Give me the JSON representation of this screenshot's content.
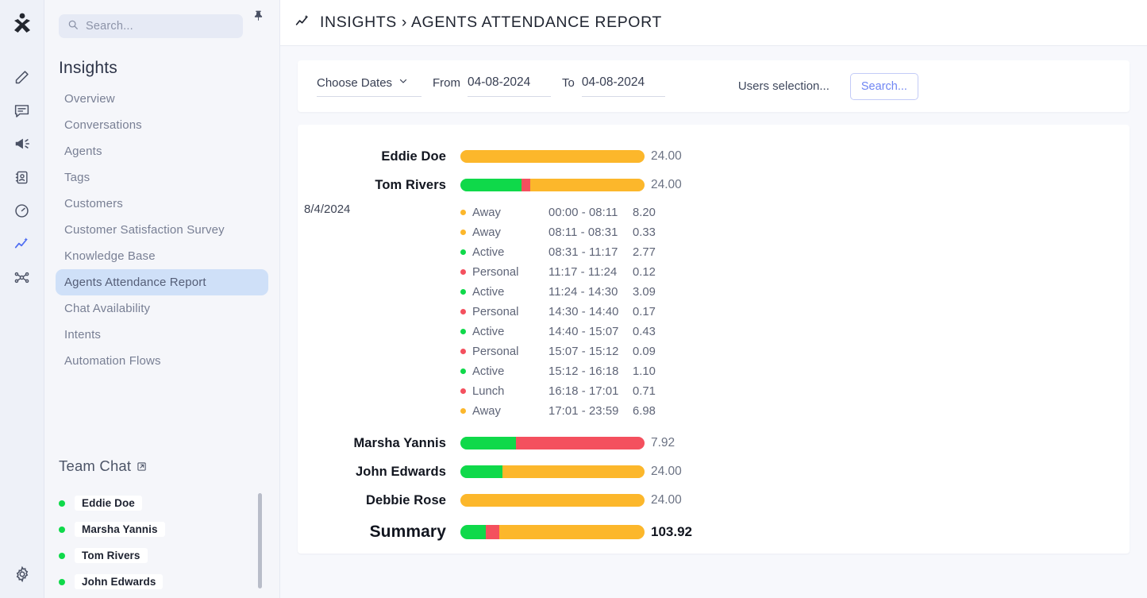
{
  "colors": {
    "active": "#0fd94a",
    "away": "#fcb72b",
    "personal": "#f4505e",
    "lunch": "#f4505e",
    "accent": "#6f85f3",
    "nav_active_bg": "#cfe0f8"
  },
  "rail": {
    "logo_name": "app-logo-icon",
    "items": [
      {
        "icon": "pencil-icon",
        "name": "compose"
      },
      {
        "icon": "chat-bubble-icon",
        "name": "conversations"
      },
      {
        "icon": "megaphone-icon",
        "name": "campaigns"
      },
      {
        "icon": "contact-card-icon",
        "name": "contacts"
      },
      {
        "icon": "gauge-icon",
        "name": "dashboard"
      },
      {
        "icon": "insights-icon",
        "name": "insights"
      },
      {
        "icon": "nodes-icon",
        "name": "automation"
      }
    ],
    "settings_icon": "gear-icon"
  },
  "search": {
    "placeholder": "Search...",
    "icon": "search-icon",
    "pin_icon": "pin-icon"
  },
  "sidebar": {
    "title": "Insights",
    "items": [
      {
        "label": "Overview",
        "active": false
      },
      {
        "label": "Conversations",
        "active": false
      },
      {
        "label": "Agents",
        "active": false
      },
      {
        "label": "Tags",
        "active": false
      },
      {
        "label": "Customers",
        "active": false
      },
      {
        "label": "Customer Satisfaction Survey",
        "active": false
      },
      {
        "label": "Knowledge Base",
        "active": false
      },
      {
        "label": "Agents Attendance Report",
        "active": true
      },
      {
        "label": "Chat Availability",
        "active": false
      },
      {
        "label": "Intents",
        "active": false
      },
      {
        "label": "Automation Flows",
        "active": false
      }
    ]
  },
  "team_chat": {
    "title": "Team Chat",
    "external_icon": "external-link-icon",
    "add_icon": "plus-icon",
    "members": [
      {
        "name": "Eddie Doe",
        "status": "online"
      },
      {
        "name": "Marsha Yannis",
        "status": "online"
      },
      {
        "name": "Tom Rivers",
        "status": "online"
      },
      {
        "name": "John Edwards",
        "status": "online"
      }
    ]
  },
  "header": {
    "icon": "insights-icon",
    "title": "INSIGHTS › AGENTS ATTENDANCE REPORT"
  },
  "filters": {
    "choose_dates_label": "Choose Dates",
    "chevron_icon": "chevron-down-icon",
    "from_label": "From",
    "from_value": "04-08-2024",
    "to_label": "To",
    "to_value": "04-08-2024",
    "users_selection_label": "Users selection...",
    "search_button": "Search..."
  },
  "chart_data": {
    "type": "bar",
    "title": "Agents Attendance Report",
    "stacked": true,
    "unit": "hours",
    "legend": [
      {
        "label": "Active",
        "color": "#0fd94a"
      },
      {
        "label": "Away",
        "color": "#fcb72b"
      },
      {
        "label": "Personal",
        "color": "#f4505e"
      },
      {
        "label": "Lunch",
        "color": "#f4505e"
      }
    ],
    "categories": [
      "Eddie Doe",
      "Tom Rivers",
      "Marsha Yannis",
      "John Edwards",
      "Debbie Rose",
      "Summary"
    ],
    "values": [
      24.0,
      24.0,
      7.92,
      24.0,
      24.0,
      103.92
    ],
    "rows": [
      {
        "name": "Eddie Doe",
        "total": "24.00",
        "segments": [
          {
            "color": "#fcb72b",
            "pct": 100
          }
        ],
        "expanded": false
      },
      {
        "name": "Tom Rivers",
        "total": "24.00",
        "segments": [
          {
            "color": "#0fd94a",
            "pct": 33
          },
          {
            "color": "#f4505e",
            "pct": 5
          },
          {
            "color": "#fcb72b",
            "pct": 62
          }
        ],
        "expanded": true,
        "date": "8/4/2024",
        "details": [
          {
            "status": "Away",
            "color": "#fcb72b",
            "time": "00:00 - 08:11",
            "duration": "8.20"
          },
          {
            "status": "Away",
            "color": "#fcb72b",
            "time": "08:11 - 08:31",
            "duration": "0.33"
          },
          {
            "status": "Active",
            "color": "#0fd94a",
            "time": "08:31 - 11:17",
            "duration": "2.77"
          },
          {
            "status": "Personal",
            "color": "#f4505e",
            "time": "11:17 - 11:24",
            "duration": "0.12"
          },
          {
            "status": "Active",
            "color": "#0fd94a",
            "time": "11:24 - 14:30",
            "duration": "3.09"
          },
          {
            "status": "Personal",
            "color": "#f4505e",
            "time": "14:30 - 14:40",
            "duration": "0.17"
          },
          {
            "status": "Active",
            "color": "#0fd94a",
            "time": "14:40 - 15:07",
            "duration": "0.43"
          },
          {
            "status": "Personal",
            "color": "#f4505e",
            "time": "15:07 - 15:12",
            "duration": "0.09"
          },
          {
            "status": "Active",
            "color": "#0fd94a",
            "time": "15:12 - 16:18",
            "duration": "1.10"
          },
          {
            "status": "Lunch",
            "color": "#f4505e",
            "time": "16:18 - 17:01",
            "duration": "0.71"
          },
          {
            "status": "Away",
            "color": "#fcb72b",
            "time": "17:01 - 23:59",
            "duration": "6.98"
          }
        ]
      },
      {
        "name": "Marsha Yannis",
        "total": "7.92",
        "segments": [
          {
            "color": "#0fd94a",
            "pct": 30
          },
          {
            "color": "#f4505e",
            "pct": 70
          }
        ],
        "expanded": false
      },
      {
        "name": "John Edwards",
        "total": "24.00",
        "segments": [
          {
            "color": "#0fd94a",
            "pct": 23
          },
          {
            "color": "#fcb72b",
            "pct": 77
          }
        ],
        "expanded": false
      },
      {
        "name": "Debbie Rose",
        "total": "24.00",
        "segments": [
          {
            "color": "#fcb72b",
            "pct": 100
          }
        ],
        "expanded": false
      },
      {
        "name": "Summary",
        "total": "103.92",
        "summary": true,
        "segments": [
          {
            "color": "#0fd94a",
            "pct": 14
          },
          {
            "color": "#f4505e",
            "pct": 7
          },
          {
            "color": "#fcb72b",
            "pct": 79
          }
        ],
        "expanded": false
      }
    ]
  }
}
